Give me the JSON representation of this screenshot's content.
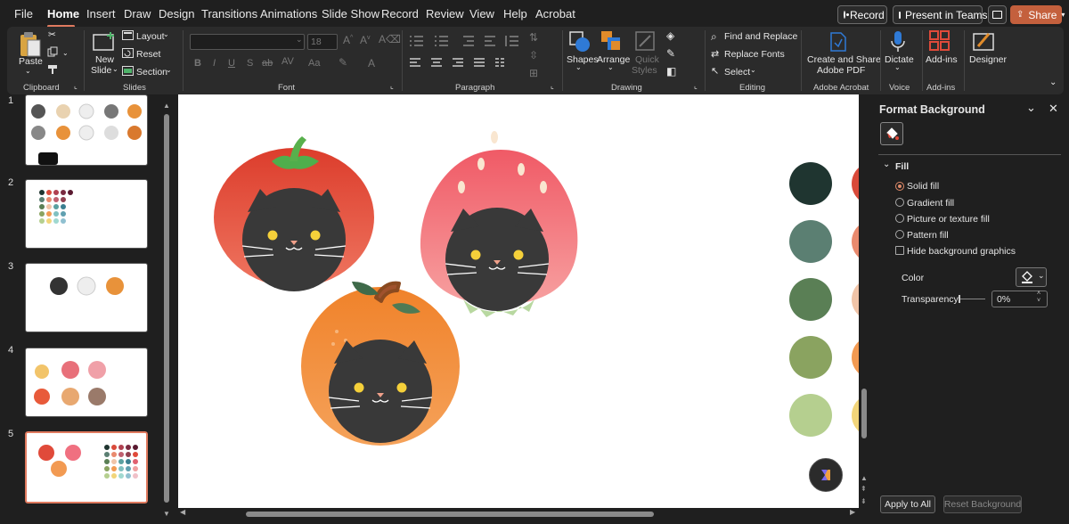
{
  "menu": {
    "file": "File",
    "home": "Home",
    "insert": "Insert",
    "draw": "Draw",
    "design": "Design",
    "transitions": "Transitions",
    "animations": "Animations",
    "slideshow": "Slide Show",
    "record": "Record",
    "review": "Review",
    "view": "View",
    "help": "Help",
    "acrobat": "Acrobat"
  },
  "titlebar": {
    "record_btn": "Record",
    "teams_btn": "Present in Teams",
    "share_btn": "Share"
  },
  "ribbon": {
    "paste": "Paste",
    "new_slide_1": "New",
    "new_slide_2": "Slide",
    "layout": "Layout",
    "reset": "Reset",
    "section": "Section",
    "font_size": "18",
    "shapes": "Shapes",
    "arrange": "Arrange",
    "quick_styles_1": "Quick",
    "quick_styles_2": "Styles",
    "find_replace": "Find and Replace",
    "replace_fonts": "Replace Fonts",
    "select": "Select",
    "create_share_1": "Create and Share",
    "create_share_2": "Adobe PDF",
    "dictate": "Dictate",
    "addins": "Add-ins",
    "designer": "Designer",
    "groups": {
      "clipboard": "Clipboard",
      "slides": "Slides",
      "font": "Font",
      "paragraph": "Paragraph",
      "drawing": "Drawing",
      "editing": "Editing",
      "adobe_acrobat": "Adobe Acrobat",
      "voice": "Voice",
      "addins": "Add-ins"
    }
  },
  "slides": [
    {
      "num": "1"
    },
    {
      "num": "2"
    },
    {
      "num": "3"
    },
    {
      "num": "4"
    },
    {
      "num": "5",
      "selected": true
    }
  ],
  "palette": {
    "column1": [
      "#1f3530",
      "#5b7f72",
      "#5a7f55",
      "#8aa360",
      "#b5cf8f"
    ],
    "column2": [
      "#d94a3a",
      "#e98a6e",
      "#f0c4a8",
      "#f29a52",
      "#f2d57a"
    ]
  },
  "format_background": {
    "title": "Format Background",
    "section": "Fill",
    "options": [
      {
        "label": "Solid fill",
        "selected": true
      },
      {
        "label": "Gradient fill",
        "selected": false
      },
      {
        "label": "Picture or texture fill",
        "selected": false
      },
      {
        "label": "Pattern fill",
        "selected": false
      }
    ],
    "hide_graphics": "Hide background graphics",
    "hide_graphics_checked": false,
    "color_label": "Color",
    "transparency_label": "Transparency",
    "transparency_value": "0%",
    "apply_all": "Apply to All",
    "reset_background": "Reset Background"
  },
  "colors": {
    "accent": "#e07a5f",
    "share": "#c4603d",
    "slide_bg": "#ffffff"
  }
}
